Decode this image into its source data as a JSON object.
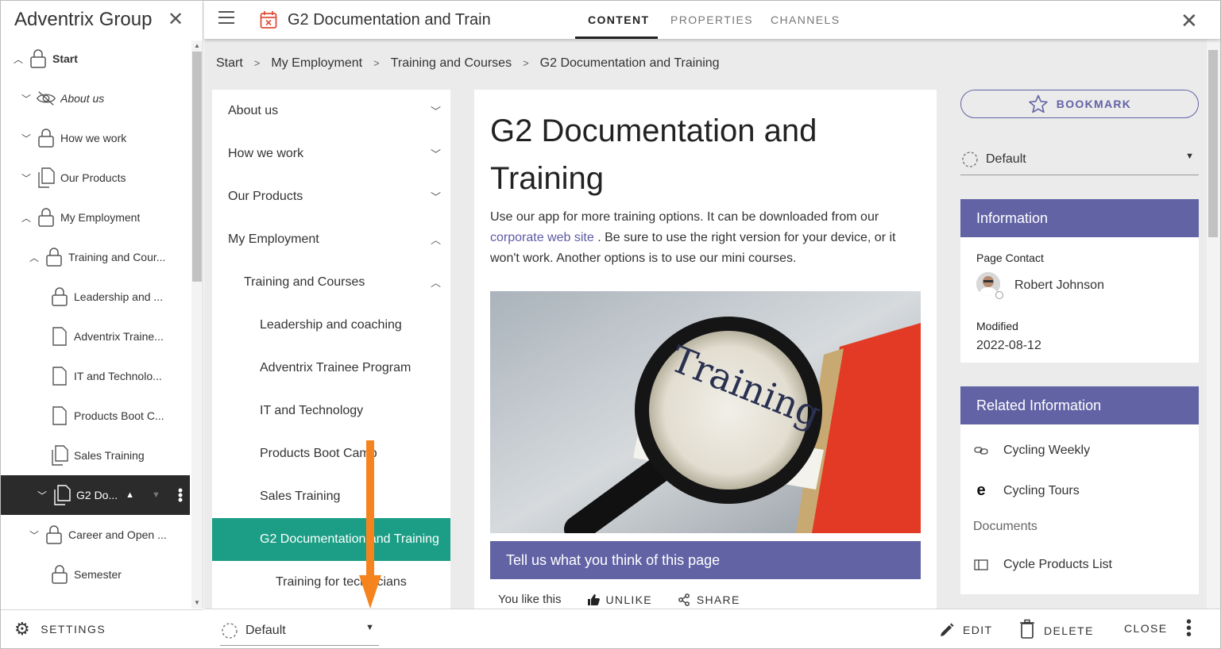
{
  "tree": {
    "title": "Adventrix Group",
    "items": [
      {
        "label": "Start",
        "chevron": "up",
        "icon": "lock-icon",
        "bold": true
      },
      {
        "label": "About us",
        "chevron": "down",
        "icon": "eye-slash-icon",
        "italic": true
      },
      {
        "label": "How we work",
        "chevron": "down",
        "icon": "lock-icon"
      },
      {
        "label": "Our Products",
        "chevron": "down",
        "icon": "pages-icon"
      },
      {
        "label": "My Employment",
        "chevron": "up",
        "icon": "lock-icon"
      },
      {
        "label": "Training and Cour...",
        "chevron": "up",
        "icon": "lock-icon"
      },
      {
        "label": "Leadership and ...",
        "chevron": "",
        "icon": "lock-icon"
      },
      {
        "label": "Adventrix Traine...",
        "chevron": "",
        "icon": "page-icon"
      },
      {
        "label": "IT and Technolo...",
        "chevron": "",
        "icon": "page-icon"
      },
      {
        "label": "Products Boot C...",
        "chevron": "",
        "icon": "page-icon"
      },
      {
        "label": "Sales Training",
        "chevron": "",
        "icon": "pages-icon"
      },
      {
        "label": "G2 Do...",
        "chevron": "down",
        "icon": "pages-icon",
        "selected": true
      },
      {
        "label": "Career and Open ...",
        "chevron": "down",
        "icon": "lock-icon"
      },
      {
        "label": "Semester",
        "chevron": "",
        "icon": "lock-icon"
      }
    ],
    "settings_label": "SETTINGS"
  },
  "topbar": {
    "page_title": "G2 Documentation and Train",
    "tabs": [
      "CONTENT",
      "PROPERTIES",
      "CHANNELS"
    ]
  },
  "breadcrumb": [
    "Start",
    "My Employment",
    "Training and Courses",
    "G2 Documentation and Training"
  ],
  "nav": {
    "items": [
      {
        "label": "About us",
        "chevron": "down"
      },
      {
        "label": "How we work",
        "chevron": "down"
      },
      {
        "label": "Our Products",
        "chevron": "down"
      },
      {
        "label": "My Employment",
        "chevron": "up"
      },
      {
        "label": "Training and Courses",
        "chevron": "up"
      },
      {
        "label": "Leadership and coaching",
        "chevron": ""
      },
      {
        "label": "Adventrix Trainee Program",
        "chevron": ""
      },
      {
        "label": "IT and Technology",
        "chevron": ""
      },
      {
        "label": "Products Boot Camp",
        "chevron": ""
      },
      {
        "label": "Sales Training",
        "chevron": ""
      },
      {
        "label": "G2 Documentation and Training",
        "chevron": "",
        "active": true
      },
      {
        "label": "Training for technicians",
        "chevron": ""
      }
    ]
  },
  "article": {
    "title": "G2 Documentation and Training",
    "body_before": "Use our app for more training options. It can be downloaded from our",
    "link_text": "corporate web site",
    "body_after": ". Be sure to use the right version for your device, or it won't work. Another options is to use our mini courses.",
    "image_word": "Training",
    "feedback_title": "Tell us what you think of this page",
    "like_status": "You like this",
    "unlike_label": "UNLIKE",
    "share_label": "SHARE"
  },
  "right": {
    "bookmark_label": "BOOKMARK",
    "select_value": "Default",
    "info": {
      "title": "Information",
      "page_contact_label": "Page Contact",
      "contact_name": "Robert Johnson",
      "modified_label": "Modified",
      "modified_value": "2022-08-12"
    },
    "related": {
      "title": "Related Information",
      "items": [
        "Cycling Weekly",
        "Cycling Tours"
      ],
      "documents_label": "Documents",
      "documents": [
        "Cycle Products List"
      ]
    }
  },
  "bottombar": {
    "select_value": "Default",
    "edit_label": "EDIT",
    "delete_label": "DELETE",
    "close_label": "CLOSE"
  },
  "colors": {
    "accent": "#6263a5",
    "active_nav": "#1b9e85",
    "arrow": "#f5841f",
    "selected_tree": "#2b2b2b"
  }
}
